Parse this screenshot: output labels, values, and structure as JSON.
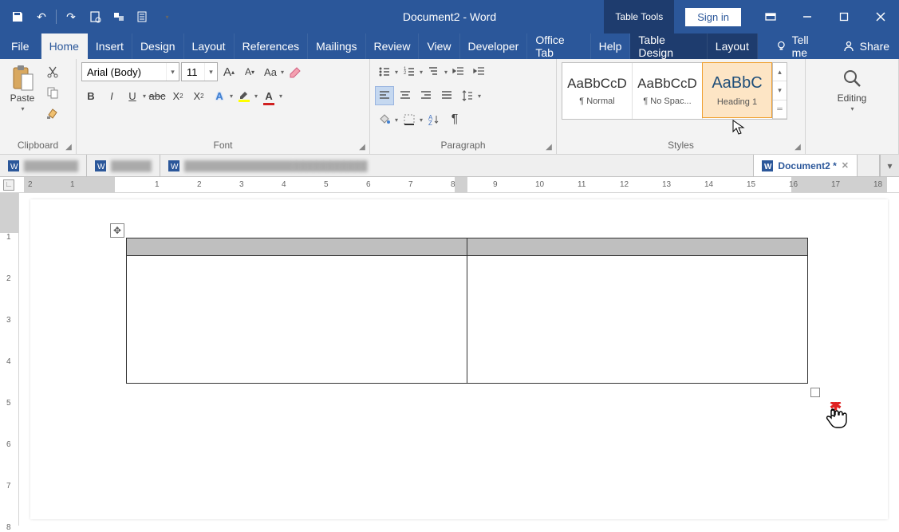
{
  "title": "Document2  -  Word",
  "table_tools": "Table Tools",
  "signin": "Sign in",
  "tabs": {
    "file": "File",
    "home": "Home",
    "insert": "Insert",
    "design": "Design",
    "layout": "Layout",
    "references": "References",
    "mailings": "Mailings",
    "review": "Review",
    "view": "View",
    "developer": "Developer",
    "office_tab": "Office Tab",
    "help": "Help",
    "table_design": "Table Design",
    "ctx_layout": "Layout",
    "tell_me": "Tell me",
    "share": "Share"
  },
  "clipboard": {
    "paste": "Paste",
    "label": "Clipboard"
  },
  "font": {
    "name": "Arial (Body)",
    "size": "11",
    "label": "Font"
  },
  "paragraph": {
    "label": "Paragraph"
  },
  "styles": {
    "label": "Styles",
    "items": [
      {
        "preview": "AaBbCcD",
        "name": "¶ Normal"
      },
      {
        "preview": "AaBbCcD",
        "name": "¶ No Spac..."
      },
      {
        "preview": "AaBbC",
        "name": "Heading 1"
      }
    ]
  },
  "editing": {
    "label": "Editing"
  },
  "doctab": {
    "name": "Document2 *"
  },
  "ruler": {
    "h": [
      "2",
      "1",
      "1",
      "2",
      "3",
      "4",
      "5",
      "6",
      "7",
      "8",
      "9",
      "10",
      "11",
      "12",
      "13",
      "14",
      "15",
      "16",
      "17",
      "18"
    ],
    "v": [
      "1",
      "2",
      "3",
      "4",
      "5",
      "6",
      "7",
      "8"
    ]
  }
}
